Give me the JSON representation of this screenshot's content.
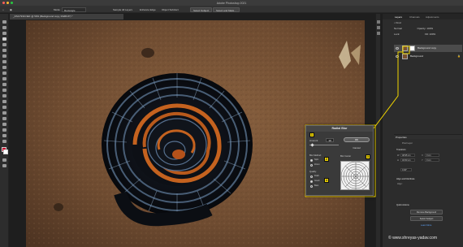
{
  "window": {
    "title": "Adobe Photoshop 2021"
  },
  "options_bar": {
    "mode_label": "Mode:",
    "mode_value": "Rectangle",
    "sample_all_layers": "Sample All Layers",
    "enhance_edge": "Enhance Edge",
    "object_subtract": "Object Subtract",
    "select_subject": "Select Subject",
    "select_and_mask": "Select and Mask..."
  },
  "document": {
    "tab_label": "_DSC7930.NEF @ 50% (Background copy, RGB/16*) *"
  },
  "panels": {
    "tabs": [
      "Layers",
      "Channels",
      "Adjustments"
    ],
    "active_tab": "Layers",
    "kind_label": "Kind",
    "blend_mode": "Normal",
    "opacity_label": "Opacity:",
    "opacity_value": "100%",
    "lock_label": "Lock:",
    "fill_label": "Fill:",
    "fill_value": "100%",
    "layers": [
      {
        "name": "Background copy",
        "selected": true
      },
      {
        "name": "Background",
        "selected": false
      }
    ]
  },
  "properties": {
    "title": "Properties",
    "kind": "Pixel Layer",
    "transform_title": "Transform",
    "w_label": "W",
    "w_value": "48.95 cm",
    "h_label": "H",
    "h_value": "32.53 cm",
    "x_label": "X",
    "x_value": "0 cm",
    "y_label": "Y",
    "y_value": "0 cm",
    "angle_value": "0.00°",
    "align_title": "Align and Distribute",
    "align_sub": "Align:",
    "quick_actions_title": "Quick Actions",
    "remove_background": "Remove Background",
    "select_subject": "Select Subject",
    "learn_more": "Learn More"
  },
  "radial_blur_dialog": {
    "title": "Radial Blur",
    "amount_label": "Amount",
    "amount_value": "10",
    "ok_label": "OK",
    "cancel_label": "Cancel",
    "blur_method_label": "Blur Method:",
    "blur_method_options": [
      "Spin",
      "Zoom"
    ],
    "blur_method_selected": "Spin",
    "blur_center_label": "Blur Center",
    "quality_label": "Quality:",
    "quality_options": [
      "Draft",
      "Good",
      "Best"
    ],
    "quality_selected": "Good",
    "badges": [
      "1",
      "2",
      "3",
      "4"
    ]
  },
  "watermark": "© www.shreyas-yadav.com",
  "colors": {
    "accent_yellow": "#f2d600",
    "foreground_swatch": "#c8102e",
    "background_swatch": "#ffffff",
    "canvas_ground": "#7b5536",
    "millipede_body": "#141820",
    "millipede_legs": "#c4621f"
  }
}
